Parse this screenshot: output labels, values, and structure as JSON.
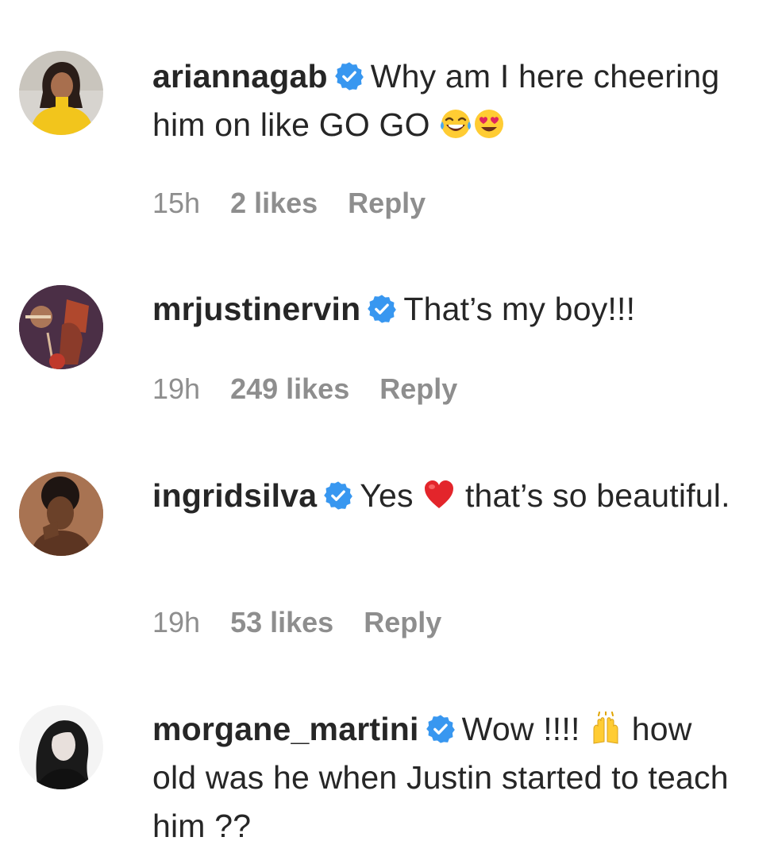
{
  "comments": [
    {
      "username": "ariannagab",
      "text": "Why am I here cheering him on like GO GO",
      "emojis": [
        "laughing-tears-emoji",
        "heart-eyes-emoji"
      ],
      "time": "15h",
      "likes": "2 likes",
      "reply": "Reply",
      "verified": true
    },
    {
      "username": "mrjustinervin",
      "text": "That’s my boy!!!",
      "time": "19h",
      "likes": "249 likes",
      "reply": "Reply",
      "verified": true
    },
    {
      "username": "ingridsilva",
      "text_before": "Yes",
      "text_after": "that’s so beautiful.",
      "emojis": [
        "red-heart-emoji"
      ],
      "time": "19h",
      "likes": "53 likes",
      "reply": "Reply",
      "verified": true
    },
    {
      "username": "morgane_martini",
      "text_before": "Wow !!!!",
      "text_after": "how old was he when Justin started to teach him ??",
      "emojis": [
        "raising-hands-emoji"
      ],
      "verified": true
    }
  ],
  "colors": {
    "text": "#262626",
    "muted": "#8e8e8e",
    "verified_blue": "#3897f0"
  }
}
